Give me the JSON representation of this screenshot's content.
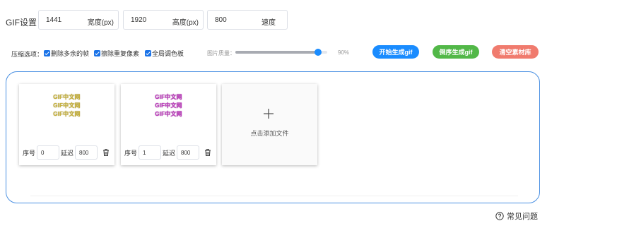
{
  "settings": {
    "label": "GIF设置：",
    "width": {
      "value": "1441",
      "unit": "宽度(px)"
    },
    "height": {
      "value": "1920",
      "unit": "高度(px)"
    },
    "speed": {
      "value": "800",
      "unit": "速度"
    }
  },
  "compression": {
    "label": "压缩选项：",
    "options": [
      {
        "label": "删除多余的帧",
        "checked": true
      },
      {
        "label": "擦除重复像素",
        "checked": true
      },
      {
        "label": "全局调色板",
        "checked": true
      }
    ],
    "quality_label": "图片质量：",
    "quality_value": "90%",
    "quality_level": 0.9
  },
  "actions": {
    "start": "开始生成gif",
    "reverse": "倒序生成gif",
    "clear": "清空素材库"
  },
  "frames": [
    {
      "preview_lines": [
        "GIF中文网",
        "GIF中文网",
        "GIF中文网"
      ],
      "order_label": "序号",
      "order": "0",
      "delay_label": "延迟",
      "delay": "800",
      "color": "#c8b23e"
    },
    {
      "preview_lines": [
        "GIF中文网",
        "GIF中文网",
        "GIF中文网"
      ],
      "order_label": "序号",
      "order": "1",
      "delay_label": "延迟",
      "delay": "800",
      "color": "#c040c0"
    }
  ],
  "add_card": {
    "label": "点击添加文件"
  },
  "faq": {
    "label": "常见问题"
  },
  "colors": {
    "accent": "#1a8cff",
    "green": "#52b848",
    "red": "#f07b6e",
    "border": "#4a90e2"
  }
}
